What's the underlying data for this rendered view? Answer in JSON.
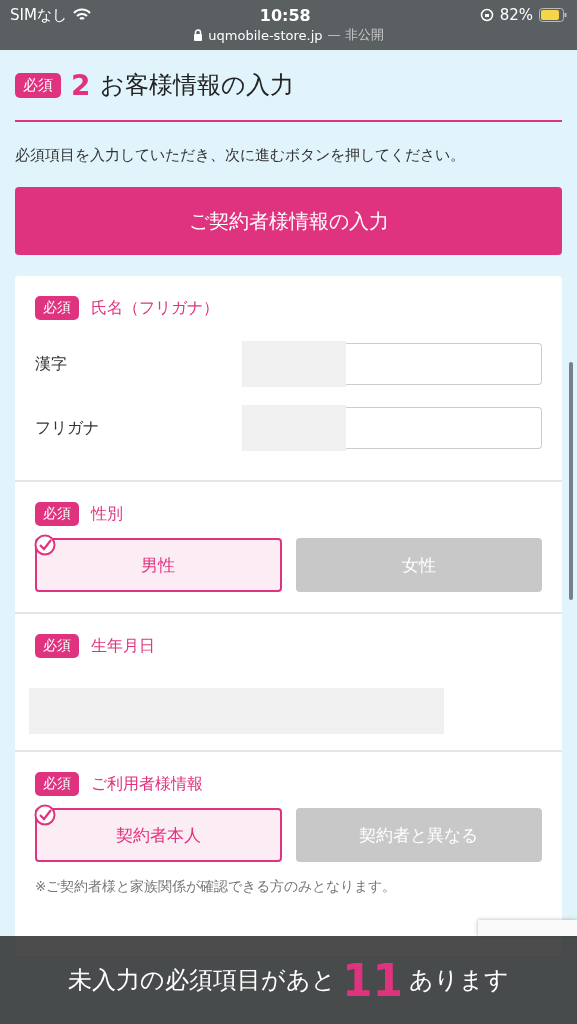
{
  "status_bar": {
    "carrier": "SIMなし",
    "time": "10:58",
    "battery": "82%",
    "url": "uqmobile-store.jp",
    "url_suffix": "— 非公開"
  },
  "section": {
    "badge": "必須",
    "number": "2",
    "title": "お客様情報の入力"
  },
  "instruction": "必須項目を入力していただき、次に進むボタンを押してください。",
  "primary_button": "ご契約者様情報の入力",
  "groups": [
    {
      "kind": "name",
      "badge": "必須",
      "label": "氏名（フリガナ）",
      "fields": [
        {
          "label": "漢字"
        },
        {
          "label": "フリガナ"
        }
      ]
    },
    {
      "kind": "choice",
      "badge": "必須",
      "label": "性別",
      "options": [
        {
          "label": "男性",
          "selected": true
        },
        {
          "label": "女性",
          "selected": false
        }
      ]
    },
    {
      "kind": "date",
      "badge": "必須",
      "label": "生年月日"
    },
    {
      "kind": "choice",
      "badge": "必須",
      "label": "ご利用者様情報",
      "options": [
        {
          "label": "契約者本人",
          "selected": true
        },
        {
          "label": "契約者と異なる",
          "selected": false
        }
      ],
      "note": "※ご契約者様と家族関係が確認できる方のみとなります。"
    }
  ],
  "footer_banner": {
    "prefix": "未入力の必須項目があと",
    "count": "11",
    "suffix": "あります"
  }
}
